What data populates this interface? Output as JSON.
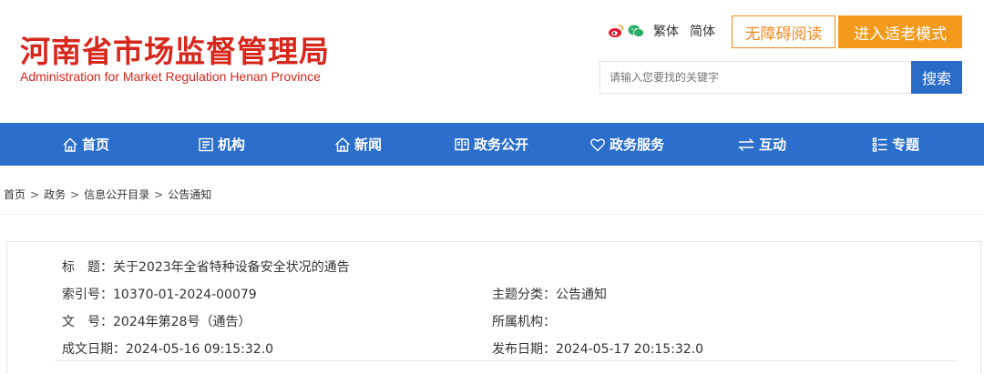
{
  "header": {
    "title": "河南省市场监督管理局",
    "subtitle": "Administration for Market Regulation Henan Province",
    "icons": [
      "weibo-icon",
      "wechat-icon"
    ],
    "lang_traditional": "繁体",
    "lang_simplified": "简体",
    "accessibility_label": "无障碍阅读",
    "elder_mode_label": "进入适老模式",
    "search_placeholder": "请输入您要找的关键字",
    "search_button": "搜索"
  },
  "nav": {
    "items": [
      {
        "label": "首页",
        "icon": "home-icon"
      },
      {
        "label": "机构",
        "icon": "building-icon"
      },
      {
        "label": "新闻",
        "icon": "house-icon"
      },
      {
        "label": "政务公开",
        "icon": "book-icon"
      },
      {
        "label": "政务服务",
        "icon": "heart-icon"
      },
      {
        "label": "互动",
        "icon": "exchange-icon"
      },
      {
        "label": "专题",
        "icon": "list-icon"
      }
    ]
  },
  "breadcrumb": {
    "items": [
      "首页",
      "政务",
      "信息公开目录",
      "公告通知"
    ],
    "separator": ">"
  },
  "info": {
    "title_label": "标　题：",
    "title_value": "关于2023年全省特种设备安全状况的通告",
    "index_label": "索引号：",
    "index_value": "10370-01-2024-00079",
    "category_label": "主题分类：",
    "category_value": "公告通知",
    "doc_no_label": "文　号：",
    "doc_no_value": "2024年第28号（通告）",
    "org_label": "所属机构：",
    "org_value": "",
    "created_label": "成文日期：",
    "created_value": "2024-05-16 09:15:32.0",
    "published_label": "发布日期：",
    "published_value": "2024-05-17 20:15:32.0"
  },
  "colors": {
    "brand_red": "#d7261b",
    "nav_blue": "#2b6ecb",
    "search_blue": "#2a6bc7",
    "accent_orange": "#f39a1c"
  }
}
